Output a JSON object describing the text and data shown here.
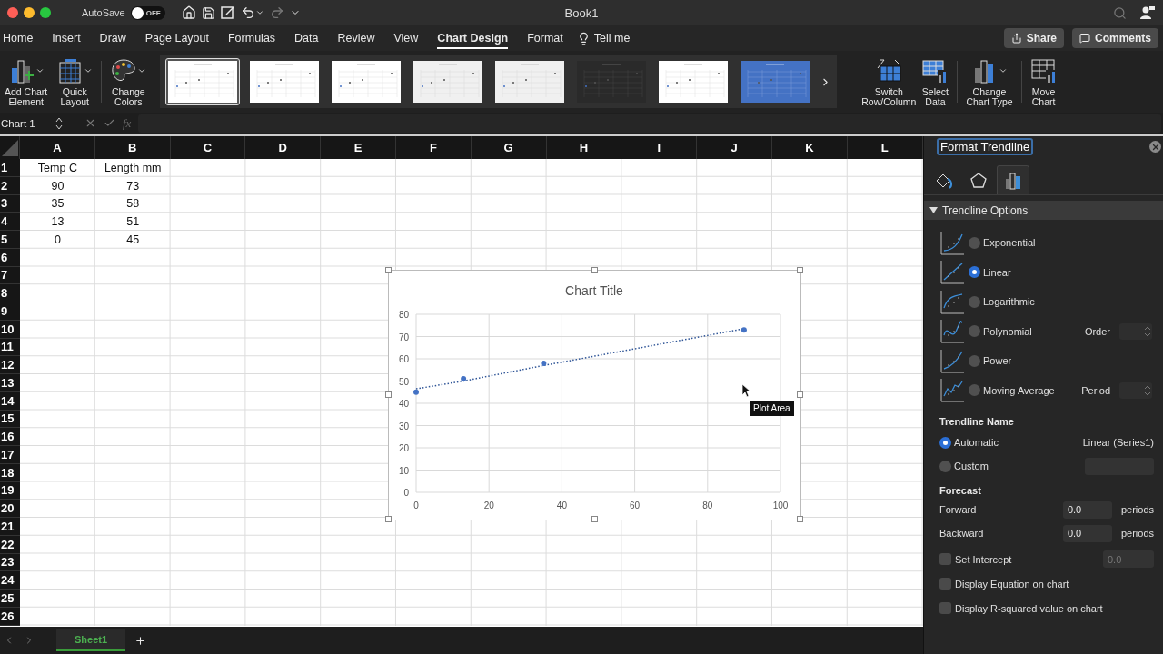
{
  "window": {
    "title": "Book1"
  },
  "quick_access": {
    "autosave_label": "AutoSave",
    "autosave_on": false,
    "autosave_state": "OFF"
  },
  "tabs": [
    {
      "label": "Home",
      "selected": false
    },
    {
      "label": "Insert",
      "selected": false
    },
    {
      "label": "Draw",
      "selected": false
    },
    {
      "label": "Page Layout",
      "selected": false
    },
    {
      "label": "Formulas",
      "selected": false
    },
    {
      "label": "Data",
      "selected": false
    },
    {
      "label": "Review",
      "selected": false
    },
    {
      "label": "View",
      "selected": false
    },
    {
      "label": "Chart Design",
      "selected": true
    },
    {
      "label": "Format",
      "selected": false
    }
  ],
  "tell_me": "Tell me",
  "share_button": "Share",
  "comments_button": "Comments",
  "ribbon": {
    "left_commands": [
      "Add Chart\nElement",
      "Quick\nLayout",
      "Change\nColors"
    ],
    "chart_styles": [
      {
        "kind": "plain",
        "selected": true
      },
      {
        "kind": "plain",
        "selected": false
      },
      {
        "kind": "plain",
        "selected": false
      },
      {
        "kind": "grey",
        "selected": false
      },
      {
        "kind": "grey",
        "selected": false
      },
      {
        "kind": "dark",
        "selected": false
      },
      {
        "kind": "plain",
        "selected": false
      },
      {
        "kind": "blue",
        "selected": false
      }
    ],
    "right_commands": [
      "Switch\nRow/Column",
      "Select\nData",
      "Change\nChart Type",
      "Move\nChart"
    ]
  },
  "formula_bar": {
    "name_box": "Chart 1",
    "fx": "fx"
  },
  "sheet": {
    "columns": [
      "A",
      "B",
      "C",
      "D",
      "E",
      "F",
      "G",
      "H",
      "I",
      "J",
      "K",
      "L"
    ],
    "rows": [
      {
        "number": "1",
        "cells": [
          "Temp C",
          "Length mm"
        ]
      },
      {
        "number": "2",
        "cells": [
          "90",
          "73"
        ]
      },
      {
        "number": "3",
        "cells": [
          "35",
          "58"
        ]
      },
      {
        "number": "4",
        "cells": [
          "13",
          "51"
        ]
      },
      {
        "number": "5",
        "cells": [
          "0",
          "45"
        ]
      },
      {
        "number": "6"
      },
      {
        "number": "7"
      },
      {
        "number": "8"
      },
      {
        "number": "9"
      },
      {
        "number": "10"
      },
      {
        "number": "11"
      },
      {
        "number": "12"
      },
      {
        "number": "13"
      },
      {
        "number": "14"
      },
      {
        "number": "15"
      },
      {
        "number": "16"
      },
      {
        "number": "17"
      },
      {
        "number": "18"
      },
      {
        "number": "19"
      },
      {
        "number": "20"
      },
      {
        "number": "21"
      },
      {
        "number": "22"
      },
      {
        "number": "23"
      },
      {
        "number": "24"
      },
      {
        "number": "25"
      },
      {
        "number": "26"
      }
    ]
  },
  "chart": {
    "tooltip": "Plot Area",
    "chart_data": {
      "type": "scatter",
      "title": "Chart Title",
      "x": [
        90,
        35,
        13,
        0
      ],
      "series": [
        {
          "color": "#4472c4",
          "values": [
            73,
            58,
            51,
            45
          ]
        },
        {
          "type": "line",
          "line_style": "dotted",
          "color": "#2f5597",
          "values": [
            73.5,
            57,
            50,
            46.5
          ]
        }
      ],
      "grid": true,
      "xlim": [
        0,
        100
      ],
      "ylim": [
        0,
        80
      ],
      "xticks": [
        0,
        20,
        40,
        60,
        80,
        100
      ],
      "yticks": [
        0,
        10,
        20,
        30,
        40,
        50,
        60,
        70,
        80
      ]
    }
  },
  "sheet_tabs": [
    {
      "label": "Sheet1",
      "selected": true
    }
  ],
  "panel": {
    "title": "Format Trendline",
    "tabs": [
      {
        "selected": false
      },
      {
        "selected": false
      },
      {
        "selected": true
      }
    ],
    "section": {
      "label": "Trendline Options",
      "expanded": true
    },
    "types": [
      {
        "label": "Exponential",
        "selected": false
      },
      {
        "label": "Linear",
        "selected": true
      },
      {
        "label": "Logarithmic",
        "selected": false
      },
      {
        "label": "Polynomial",
        "selected": false,
        "option_label": "Order"
      },
      {
        "label": "Power",
        "selected": false
      },
      {
        "label": "Moving Average",
        "selected": false,
        "option_label": "Period"
      }
    ],
    "name_heading": "Trendline Name",
    "name_options": [
      {
        "label": "Automatic",
        "selected": true,
        "value": "Linear (Series1)"
      },
      {
        "label": "Custom",
        "selected": false
      }
    ],
    "forecast_heading": "Forecast",
    "forecast": [
      {
        "label": "Forward",
        "value": "0.0",
        "unit": "periods"
      },
      {
        "label": "Backward",
        "value": "0.0",
        "unit": "periods"
      }
    ],
    "checkboxes": [
      {
        "label": "Set Intercept",
        "checked": false,
        "placeholder": "0.0"
      },
      {
        "label": "Display Equation on chart",
        "checked": false
      },
      {
        "label": "Display R-squared value on chart",
        "checked": false
      }
    ]
  }
}
